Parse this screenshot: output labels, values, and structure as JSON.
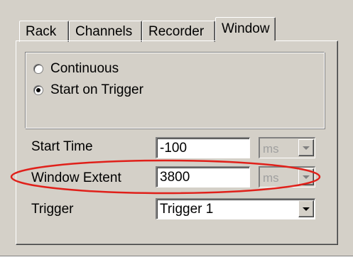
{
  "tabs": [
    {
      "label": "Rack"
    },
    {
      "label": "Channels"
    },
    {
      "label": "Recorder"
    },
    {
      "label": "Window",
      "active": true
    }
  ],
  "trigger_mode": {
    "options": [
      {
        "label": "Continuous",
        "checked": false
      },
      {
        "label": "Start on Trigger",
        "checked": true
      }
    ]
  },
  "start_time": {
    "label": "Start Time",
    "value": "-100",
    "unit": "ms"
  },
  "window_extent": {
    "label": "Window Extent",
    "value": "3800",
    "unit": "ms"
  },
  "trigger": {
    "label": "Trigger",
    "value": "Trigger 1"
  },
  "colors": {
    "annotation": "#e0201a",
    "window_bg": "#d4d0c8"
  }
}
